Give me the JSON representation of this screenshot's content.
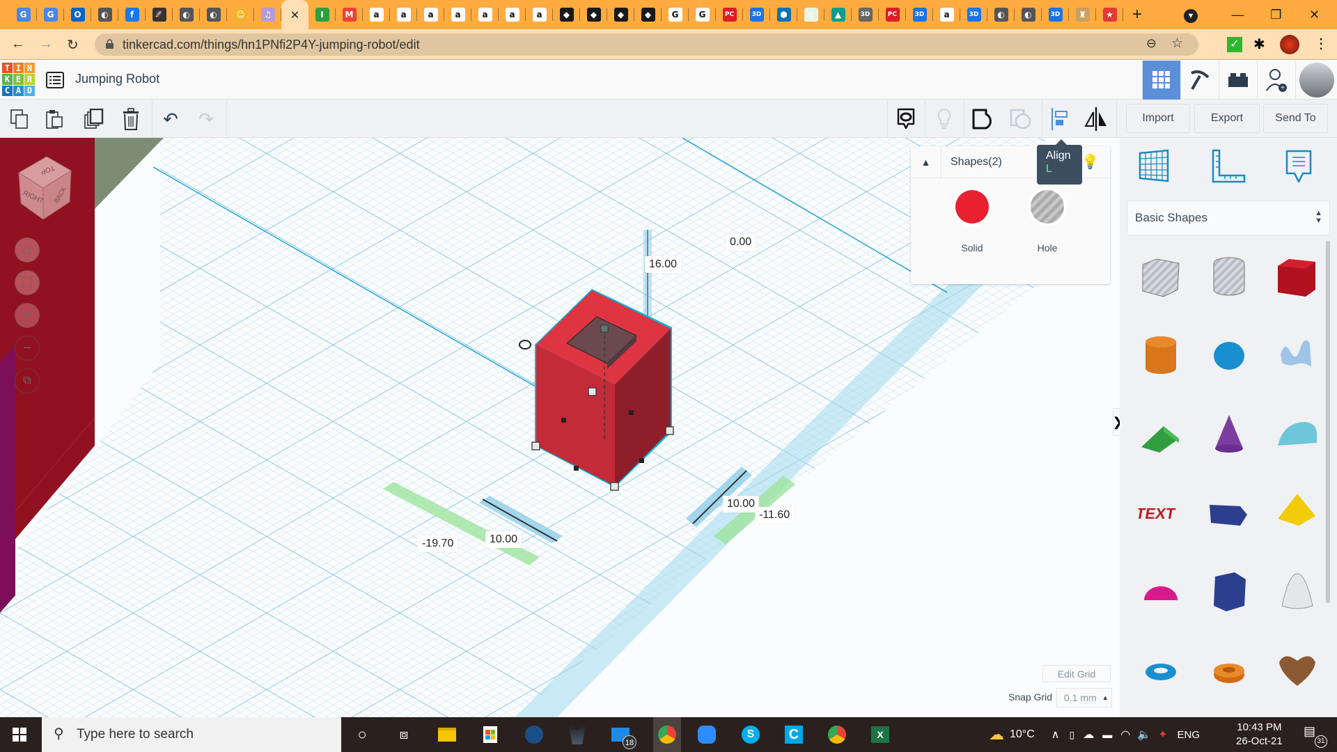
{
  "browser": {
    "tabs": [
      {
        "icon": "google-translate-icon",
        "color": "#4a86e8",
        "glyph": "G"
      },
      {
        "icon": "google-translate-icon",
        "color": "#4a86e8",
        "glyph": "G"
      },
      {
        "icon": "outlook-icon",
        "color": "#0a64c8",
        "glyph": "O"
      },
      {
        "icon": "globe-icon",
        "color": "#555",
        "glyph": "◐"
      },
      {
        "icon": "facebook-icon",
        "color": "#1877f2",
        "glyph": "f"
      },
      {
        "icon": "rocket-icon",
        "color": "#333",
        "glyph": "🚀"
      },
      {
        "icon": "globe-icon",
        "color": "#555",
        "glyph": "◐"
      },
      {
        "icon": "globe-icon",
        "color": "#555",
        "glyph": "◐"
      },
      {
        "icon": "robot-avatar-icon",
        "color": "#f0b429",
        "glyph": "☺"
      },
      {
        "icon": "music-icon",
        "color": "#b59ad8",
        "glyph": "♫"
      },
      {
        "icon": "close-tab-icon",
        "color": "#ffdfb3",
        "glyph": "✕",
        "active": true
      },
      {
        "icon": "bookmark-i-icon",
        "color": "#2e9e3f",
        "glyph": "I"
      },
      {
        "icon": "gmail-icon",
        "color": "#ea4335",
        "glyph": "M"
      },
      {
        "icon": "amazon-icon",
        "color": "#fff",
        "glyph": "a"
      },
      {
        "icon": "amazon-icon",
        "color": "#fff",
        "glyph": "a"
      },
      {
        "icon": "amazon-icon",
        "color": "#fff",
        "glyph": "a"
      },
      {
        "icon": "amazon-icon",
        "color": "#fff",
        "glyph": "a"
      },
      {
        "icon": "amazon-icon",
        "color": "#fff",
        "glyph": "a"
      },
      {
        "icon": "amazon-icon",
        "color": "#fff",
        "glyph": "a"
      },
      {
        "icon": "amazon-icon",
        "color": "#fff",
        "glyph": "a"
      },
      {
        "icon": "diamond-icon",
        "color": "#1a1a1a",
        "glyph": "◆"
      },
      {
        "icon": "diamond-icon",
        "color": "#1a1a1a",
        "glyph": "◆"
      },
      {
        "icon": "diamond-icon",
        "color": "#1a1a1a",
        "glyph": "◆"
      },
      {
        "icon": "diamond-icon",
        "color": "#1a1a1a",
        "glyph": "◆"
      },
      {
        "icon": "google-icon",
        "color": "#fff",
        "glyph": "G"
      },
      {
        "icon": "google-icon",
        "color": "#fff",
        "glyph": "G"
      },
      {
        "icon": "pcmag-icon",
        "color": "#e01b24",
        "glyph": "PC"
      },
      {
        "icon": "3d-icon",
        "color": "#1a73e8",
        "glyph": "3D"
      },
      {
        "icon": "hex-icon",
        "color": "#0b73b3",
        "glyph": "⬢"
      },
      {
        "icon": "doc-icon",
        "color": "#e8f4e8",
        "glyph": "▯"
      },
      {
        "icon": "mountain-icon",
        "color": "#0f9d8a",
        "glyph": "▲"
      },
      {
        "icon": "3d-cube-icon",
        "color": "#666",
        "glyph": "3D"
      },
      {
        "icon": "pcmag-icon",
        "color": "#e01b24",
        "glyph": "PC"
      },
      {
        "icon": "3d-icon",
        "color": "#1a73e8",
        "glyph": "3D"
      },
      {
        "icon": "amazon-icon",
        "color": "#fff",
        "glyph": "a"
      },
      {
        "icon": "3d-icon",
        "color": "#1a73e8",
        "glyph": "3D"
      },
      {
        "icon": "globe-icon",
        "color": "#555",
        "glyph": "◐"
      },
      {
        "icon": "globe-icon",
        "color": "#555",
        "glyph": "◐"
      },
      {
        "icon": "3d-icon",
        "color": "#1a73e8",
        "glyph": "3D"
      },
      {
        "icon": "emblem-icon",
        "color": "#c8a060",
        "glyph": "♜"
      },
      {
        "icon": "star-icon",
        "color": "#e53935",
        "glyph": "★"
      }
    ],
    "new_tab": "+",
    "url": "tinkercad.com/things/hn1PNfi2P4Y-jumping-robot/edit"
  },
  "app": {
    "logo_letters": [
      [
        "T",
        "#e8502b"
      ],
      [
        "I",
        "#f07d26"
      ],
      [
        "N",
        "#f59b2d"
      ],
      [
        "K",
        "#54b748"
      ],
      [
        "E",
        "#7fc242"
      ],
      [
        "R",
        "#b8d530"
      ],
      [
        "C",
        "#1e73be"
      ],
      [
        "A",
        "#2a8dd4"
      ],
      [
        "D",
        "#52b1e5"
      ]
    ],
    "title": "Jumping Robot",
    "toolbar": {
      "import": "Import",
      "export": "Export",
      "send_to": "Send To"
    },
    "tooltip": {
      "title": "Align",
      "shortcut": "L"
    },
    "inspector": {
      "title": "Shapes(2)",
      "solid": "Solid",
      "hole": "Hole",
      "solid_color": "#e8202f"
    },
    "view_cube": {
      "top": "TOP",
      "right": "RIGHT",
      "back": "BACK"
    },
    "dimensions": {
      "height": "16.00",
      "elevation": "0.00",
      "width": "10.00",
      "x_offset": "-19.70",
      "depth": "10.00",
      "y_offset": "-11.60"
    },
    "shape_library": {
      "selected": "Basic Shapes",
      "shapes": [
        "Box Hole",
        "Cylinder Hole",
        "Box",
        "Cylinder",
        "Sphere",
        "Scribble",
        "Roof",
        "Cone",
        "Round Roof",
        "Text",
        "Wedge",
        "Pyramid",
        "Half Sphere",
        "Polygon",
        "Paraboloid",
        "Torus",
        "Tube",
        "Heart"
      ]
    },
    "grid": {
      "edit": "Edit Grid",
      "snap_label": "Snap Grid",
      "snap_value": "0.1 mm"
    }
  },
  "taskbar": {
    "search_placeholder": "Type here to search",
    "mail_badge": "18",
    "temperature": "10°C",
    "language": "ENG",
    "time": "10:43 PM",
    "date": "26-Oct-21",
    "notifications": "31"
  }
}
